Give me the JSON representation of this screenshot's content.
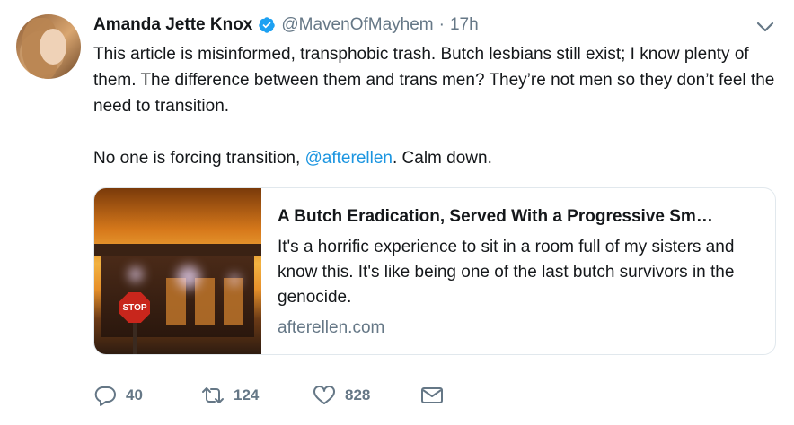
{
  "author": {
    "name": "Amanda Jette Knox",
    "handle": "@MavenOfMayhem",
    "separator": "·",
    "time": "17h"
  },
  "tweet": {
    "paragraph1": "This article is misinformed, transphobic trash. Butch lesbians still exist; I know plenty of them. The difference between them and trans men? They’re not men so they don’t feel the need to transition.",
    "paragraph2_before": "No one is forcing transition, ",
    "paragraph2_mention": "@afterellen",
    "paragraph2_after": ". Calm down."
  },
  "card": {
    "title": "A Butch Eradication, Served With a Progressive Sm…",
    "description": "It's a horrific experience to sit in a room full of my sisters and know this. It's like being one of the last butch survivors in the genocide.",
    "domain": "afterellen.com",
    "image_sign_text": "STOP"
  },
  "actions": {
    "replies": "40",
    "retweets": "124",
    "likes": "828"
  },
  "colors": {
    "link": "#1b95e0",
    "secondary": "#657786",
    "verified": "#1da1f2"
  },
  "icons": {
    "verified": "verified-badge-icon",
    "menu": "chevron-down-icon",
    "reply": "reply-icon",
    "retweet": "retweet-icon",
    "like": "heart-icon",
    "dm": "envelope-icon"
  }
}
